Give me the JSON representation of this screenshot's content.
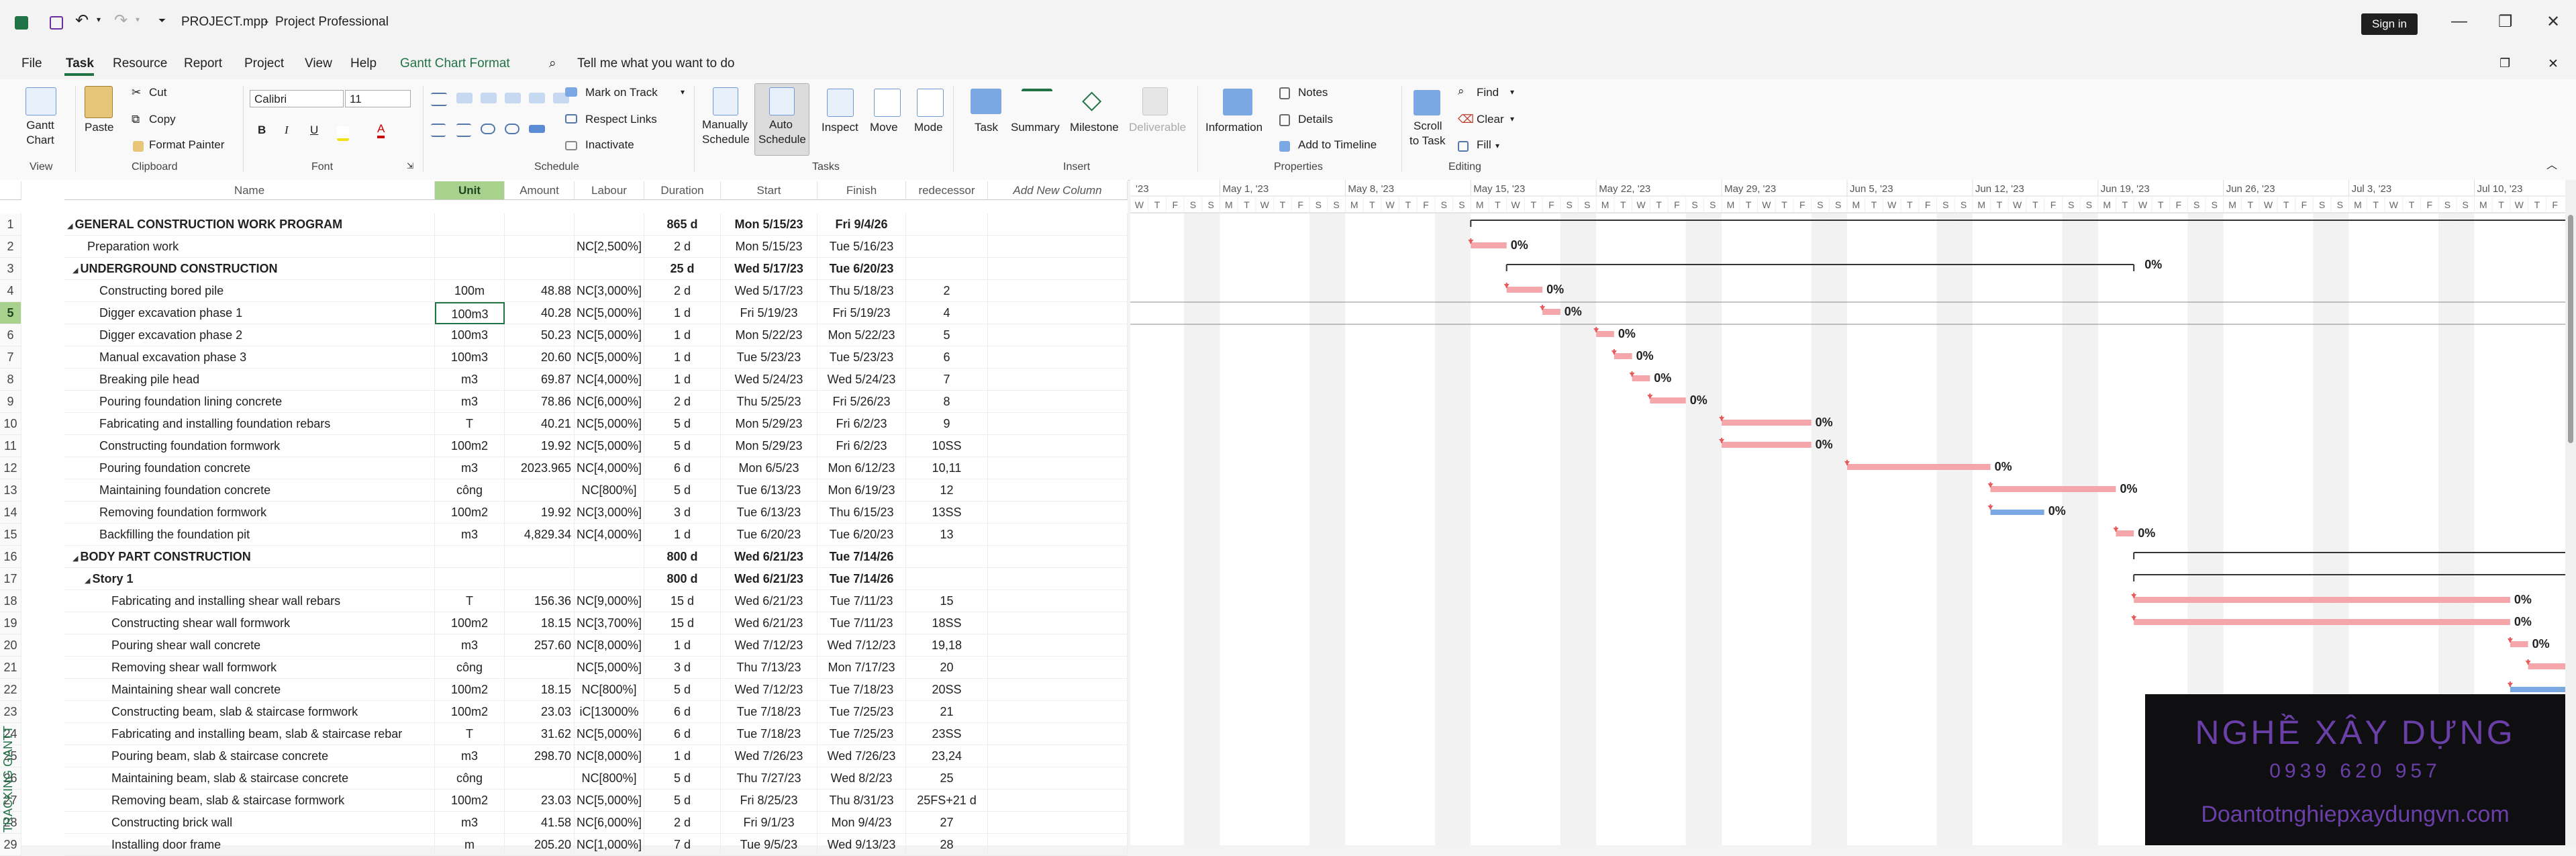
{
  "titlebar": {
    "file_name": "PROJECT.mpp",
    "separator": "-",
    "app_name": "Project Professional",
    "sign_in": "Sign in"
  },
  "menu": {
    "tabs": [
      "File",
      "Task",
      "Resource",
      "Report",
      "Project",
      "View",
      "Help",
      "Gantt Chart Format"
    ],
    "active_tab": "Task",
    "search_placeholder": "Tell me what you want to do"
  },
  "ribbon": {
    "view_group": {
      "label": "View",
      "gantt_chart": "Gantt\nChart"
    },
    "clipboard": {
      "label": "Clipboard",
      "paste": "Paste",
      "cut": "Cut",
      "copy": "Copy",
      "format_painter": "Format Painter"
    },
    "font": {
      "label": "Font",
      "family": "Calibri",
      "size": "11",
      "bold": "B",
      "italic": "I",
      "underline": "U",
      "font_color": "A"
    },
    "schedule": {
      "label": "Schedule",
      "mark_on_track": "Mark on Track",
      "respect_links": "Respect Links",
      "inactivate": "Inactivate"
    },
    "tasks": {
      "label": "Tasks",
      "manually": "Manually",
      "manually2": "Schedule",
      "auto": "Auto",
      "auto2": "Schedule",
      "inspect": "Inspect",
      "move": "Move",
      "mode": "Mode"
    },
    "insert": {
      "label": "Insert",
      "task": "Task",
      "summary": "Summary",
      "milestone": "Milestone",
      "deliverable": "Deliverable"
    },
    "properties": {
      "label": "Properties",
      "information": "Information",
      "notes": "Notes",
      "details": "Details",
      "add_to_timeline": "Add to Timeline"
    },
    "editing": {
      "label": "Editing",
      "scroll": "Scroll",
      "scroll2": "to Task",
      "find": "Find",
      "clear": "Clear",
      "fill": "Fill"
    }
  },
  "columns": [
    "Name",
    "Unit",
    "Amount",
    "Labour",
    "Duration",
    "Start",
    "Finish",
    "redecessor",
    "Add New Column"
  ],
  "selected_row": 5,
  "rows": [
    {
      "id": "1",
      "name": "GENERAL CONSTRUCTION WORK PROGRAM",
      "indent": 0,
      "summary": true,
      "unit": "",
      "amount": "",
      "labour": "",
      "duration": "865 d",
      "start": "Mon 5/15/23",
      "finish": "Fri 9/4/26",
      "pred": ""
    },
    {
      "id": "2",
      "name": "Preparation work",
      "indent": 1,
      "summary": false,
      "unit": "",
      "amount": "",
      "labour": "NC[2,500%]",
      "duration": "2 d",
      "start": "Mon 5/15/23",
      "finish": "Tue 5/16/23",
      "pred": ""
    },
    {
      "id": "3",
      "name": "UNDERGROUND CONSTRUCTION",
      "indent": 1,
      "summary": true,
      "unit": "",
      "amount": "",
      "labour": "",
      "duration": "25 d",
      "start": "Wed 5/17/23",
      "finish": "Tue 6/20/23",
      "pred": ""
    },
    {
      "id": "4",
      "name": "Constructing bored pile",
      "indent": 2,
      "summary": false,
      "unit": "100m",
      "amount": "48.88",
      "labour": "NC[3,000%]",
      "duration": "2 d",
      "start": "Wed 5/17/23",
      "finish": "Thu 5/18/23",
      "pred": "2"
    },
    {
      "id": "5",
      "name": "Digger excavation phase 1",
      "indent": 2,
      "summary": false,
      "unit": "100m3",
      "amount": "40.28",
      "labour": "NC[5,000%]",
      "duration": "1 d",
      "start": "Fri 5/19/23",
      "finish": "Fri 5/19/23",
      "pred": "4"
    },
    {
      "id": "6",
      "name": "Digger excavation phase 2",
      "indent": 2,
      "summary": false,
      "unit": "100m3",
      "amount": "50.23",
      "labour": "NC[5,000%]",
      "duration": "1 d",
      "start": "Mon 5/22/23",
      "finish": "Mon 5/22/23",
      "pred": "5"
    },
    {
      "id": "7",
      "name": "Manual excavation phase 3",
      "indent": 2,
      "summary": false,
      "unit": "100m3",
      "amount": "20.60",
      "labour": "NC[5,000%]",
      "duration": "1 d",
      "start": "Tue 5/23/23",
      "finish": "Tue 5/23/23",
      "pred": "6"
    },
    {
      "id": "8",
      "name": "Breaking pile head",
      "indent": 2,
      "summary": false,
      "unit": "m3",
      "amount": "69.87",
      "labour": "NC[4,000%]",
      "duration": "1 d",
      "start": "Wed 5/24/23",
      "finish": "Wed 5/24/23",
      "pred": "7"
    },
    {
      "id": "9",
      "name": "Pouring foundation lining concrete",
      "indent": 2,
      "summary": false,
      "unit": "m3",
      "amount": "78.86",
      "labour": "NC[6,000%]",
      "duration": "2 d",
      "start": "Thu 5/25/23",
      "finish": "Fri 5/26/23",
      "pred": "8"
    },
    {
      "id": "10",
      "name": "Fabricating and installing foundation rebars",
      "indent": 2,
      "summary": false,
      "unit": "T",
      "amount": "40.21",
      "labour": "NC[5,000%]",
      "duration": "5 d",
      "start": "Mon 5/29/23",
      "finish": "Fri 6/2/23",
      "pred": "9"
    },
    {
      "id": "11",
      "name": "Constructing foundation formwork",
      "indent": 2,
      "summary": false,
      "unit": "100m2",
      "amount": "19.92",
      "labour": "NC[5,000%]",
      "duration": "5 d",
      "start": "Mon 5/29/23",
      "finish": "Fri 6/2/23",
      "pred": "10SS"
    },
    {
      "id": "12",
      "name": "Pouring foundation concrete",
      "indent": 2,
      "summary": false,
      "unit": "m3",
      "amount": "2023.965",
      "labour": "NC[4,000%]",
      "duration": "6 d",
      "start": "Mon 6/5/23",
      "finish": "Mon 6/12/23",
      "pred": "10,11"
    },
    {
      "id": "13",
      "name": "Maintaining foundation concrete",
      "indent": 2,
      "summary": false,
      "unit": "công",
      "amount": "",
      "labour": "NC[800%]",
      "duration": "5 d",
      "start": "Tue 6/13/23",
      "finish": "Mon 6/19/23",
      "pred": "12"
    },
    {
      "id": "14",
      "name": "Removing foundation formwork",
      "indent": 2,
      "summary": false,
      "unit": "100m2",
      "amount": "19.92",
      "labour": "NC[3,000%]",
      "duration": "3 d",
      "start": "Tue 6/13/23",
      "finish": "Thu 6/15/23",
      "pred": "13SS"
    },
    {
      "id": "15",
      "name": "Backfilling the foundation pit",
      "indent": 2,
      "summary": false,
      "unit": "m3",
      "amount": "4,829.34",
      "labour": "NC[4,000%]",
      "duration": "1 d",
      "start": "Tue 6/20/23",
      "finish": "Tue 6/20/23",
      "pred": "13"
    },
    {
      "id": "16",
      "name": "BODY PART CONSTRUCTION",
      "indent": 1,
      "summary": true,
      "unit": "",
      "amount": "",
      "labour": "",
      "duration": "800 d",
      "start": "Wed 6/21/23",
      "finish": "Tue 7/14/26",
      "pred": ""
    },
    {
      "id": "17",
      "name": "Story 1",
      "indent": 2,
      "summary": true,
      "unit": "",
      "amount": "",
      "labour": "",
      "duration": "800 d",
      "start": "Wed 6/21/23",
      "finish": "Tue 7/14/26",
      "pred": ""
    },
    {
      "id": "18",
      "name": "Fabricating and installing shear wall rebars",
      "indent": 3,
      "summary": false,
      "unit": "T",
      "amount": "156.36",
      "labour": "NC[9,000%]",
      "duration": "15 d",
      "start": "Wed 6/21/23",
      "finish": "Tue 7/11/23",
      "pred": "15"
    },
    {
      "id": "19",
      "name": "Constructing shear wall formwork",
      "indent": 3,
      "summary": false,
      "unit": "100m2",
      "amount": "18.15",
      "labour": "NC[3,700%]",
      "duration": "15 d",
      "start": "Wed 6/21/23",
      "finish": "Tue 7/11/23",
      "pred": "18SS"
    },
    {
      "id": "20",
      "name": "Pouring shear wall concrete",
      "indent": 3,
      "summary": false,
      "unit": "m3",
      "amount": "257.60",
      "labour": "NC[8,000%]",
      "duration": "1 d",
      "start": "Wed 7/12/23",
      "finish": "Wed 7/12/23",
      "pred": "19,18"
    },
    {
      "id": "21",
      "name": "Removing shear wall formwork",
      "indent": 3,
      "summary": false,
      "unit": "công",
      "amount": "",
      "labour": "NC[5,000%]",
      "duration": "3 d",
      "start": "Thu 7/13/23",
      "finish": "Mon 7/17/23",
      "pred": "20"
    },
    {
      "id": "22",
      "name": "Maintaining shear wall concrete",
      "indent": 3,
      "summary": false,
      "unit": "100m2",
      "amount": "18.15",
      "labour": "NC[800%]",
      "duration": "5 d",
      "start": "Wed 7/12/23",
      "finish": "Tue 7/18/23",
      "pred": "20SS"
    },
    {
      "id": "23",
      "name": "Constructing beam, slab & staircase formwork",
      "indent": 3,
      "summary": false,
      "unit": "100m2",
      "amount": "23.03",
      "labour": "iC[13000%",
      "duration": "6 d",
      "start": "Tue 7/18/23",
      "finish": "Tue 7/25/23",
      "pred": "21"
    },
    {
      "id": "24",
      "name": "Fabricating and installing beam, slab & staircase rebar",
      "indent": 3,
      "summary": false,
      "unit": "T",
      "amount": "31.62",
      "labour": "NC[5,000%]",
      "duration": "6 d",
      "start": "Tue 7/18/23",
      "finish": "Tue 7/25/23",
      "pred": "23SS"
    },
    {
      "id": "25",
      "name": "Pouring beam, slab & staircase concrete",
      "indent": 3,
      "summary": false,
      "unit": "m3",
      "amount": "298.70",
      "labour": "NC[8,000%]",
      "duration": "1 d",
      "start": "Wed 7/26/23",
      "finish": "Wed 7/26/23",
      "pred": "23,24"
    },
    {
      "id": "26",
      "name": "Maintaining beam, slab & staircase concrete",
      "indent": 3,
      "summary": false,
      "unit": "công",
      "amount": "",
      "labour": "NC[800%]",
      "duration": "5 d",
      "start": "Thu 7/27/23",
      "finish": "Wed 8/2/23",
      "pred": "25"
    },
    {
      "id": "27",
      "name": "Removing beam, slab & staircase formwork",
      "indent": 3,
      "summary": false,
      "unit": "100m2",
      "amount": "23.03",
      "labour": "NC[5,000%]",
      "duration": "5 d",
      "start": "Fri 8/25/23",
      "finish": "Thu 8/31/23",
      "pred": "25FS+21 d"
    },
    {
      "id": "28",
      "name": "Constructing brick wall",
      "indent": 3,
      "summary": false,
      "unit": "m3",
      "amount": "41.58",
      "labour": "NC[6,000%]",
      "duration": "2 d",
      "start": "Fri 9/1/23",
      "finish": "Mon 9/4/23",
      "pred": "27"
    },
    {
      "id": "29",
      "name": "Installing door frame",
      "indent": 3,
      "summary": false,
      "unit": "m",
      "amount": "205.20",
      "labour": "NC[1,000%]",
      "duration": "7 d",
      "start": "Tue 9/5/23",
      "finish": "Wed 9/13/23",
      "pred": "28"
    }
  ],
  "timeline": {
    "weeks": [
      "'23",
      "May 1, '23",
      "May 8, '23",
      "May 15, '23",
      "May 22, '23",
      "May 29, '23",
      "Jun 5, '23",
      "Jun 12, '23",
      "Jun 19, '23",
      "Jun 26, '23",
      "Jul 3, '23",
      "Jul 10, '23"
    ],
    "days": [
      "M",
      "T",
      "W",
      "T",
      "F",
      "S",
      "S"
    ],
    "progress_label": "0%"
  },
  "sidebar_label": "TRACKING GANTT",
  "watermark": {
    "line1": "NGHỀ XÂY DỰNG",
    "line2": "0939 620 957",
    "line3": "Doantotnghiepxaydungvn.com"
  },
  "colors": {
    "accent": "#217346",
    "selected": "#a9d18e",
    "task_bar": "#f4a6aa",
    "baseline_bar": "#7ba7e3",
    "watermark_purple": "#6a3fa8"
  }
}
